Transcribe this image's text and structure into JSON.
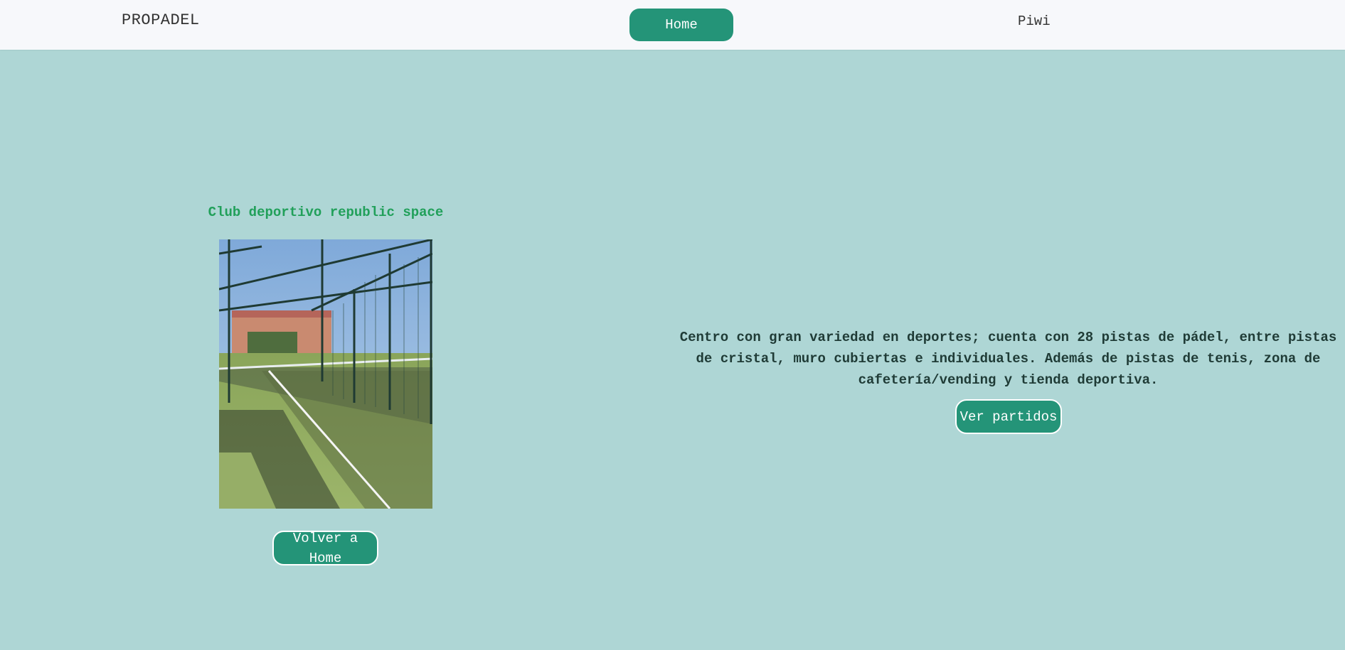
{
  "navbar": {
    "brand": "PROPADEL",
    "home_label": "Home",
    "user_name": "Piwi"
  },
  "club": {
    "title": "Club deportivo republic space",
    "photo_subject": "padel-court-photo",
    "back_button_label": "Volver a Home"
  },
  "details": {
    "description": "Centro con gran variedad en deportes; cuenta con 28 pistas de pádel, entre pistas de cristal, muro cubiertas e individuales. Además de pistas de tenis, zona de cafetería/vending y tienda deportiva.",
    "matches_button_label": "Ver partidos"
  },
  "colors": {
    "background": "#aed6d5",
    "navbar": "#f7f8fb",
    "accent": "#249478",
    "title_green": "#21a05a",
    "text_dark": "#1f3b36"
  }
}
